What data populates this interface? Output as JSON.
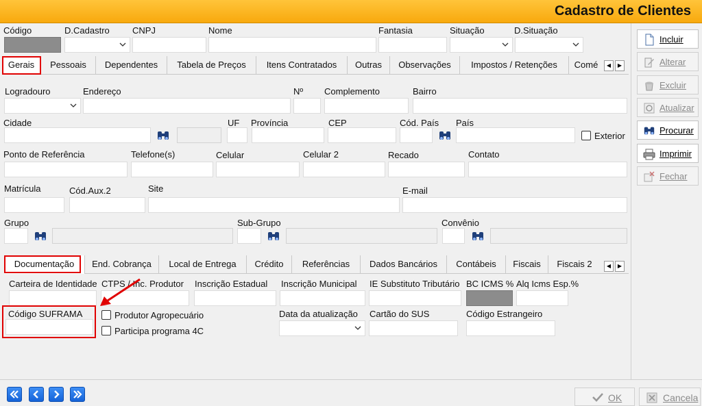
{
  "window": {
    "title": "Cadastro de Clientes"
  },
  "header_fields": {
    "codigo": "Código",
    "d_cadastro": "D.Cadastro",
    "cnpj": "CNPJ",
    "nome": "Nome",
    "fantasia": "Fantasia",
    "situacao": "Situação",
    "d_situacao": "D.Situação"
  },
  "main_tabs": [
    "Gerais",
    "Pessoais",
    "Dependentes",
    "Tabela de Preços",
    "Itens Contratados",
    "Outras",
    "Observações",
    "Impostos / Retenções",
    "Comé"
  ],
  "gerais": {
    "logradouro": "Logradouro",
    "endereco": "Endereço",
    "numero": "Nº",
    "complemento": "Complemento",
    "bairro": "Bairro",
    "cidade": "Cidade",
    "uf": "UF",
    "provincia": "Província",
    "cep": "CEP",
    "cod_pais": "Cód. País",
    "pais": "País",
    "exterior": "Exterior",
    "ponto_referencia": "Ponto de Referência",
    "telefones": "Telefone(s)",
    "celular": "Celular",
    "celular2": "Celular 2",
    "recado": "Recado",
    "contato": "Contato",
    "matricula": "Matrícula",
    "cod_aux2": "Cód.Aux.2",
    "site": "Site",
    "email": "E-mail",
    "grupo": "Grupo",
    "sub_grupo": "Sub-Grupo",
    "convenio": "Convênio"
  },
  "sub_tabs": [
    "Documentação",
    "End. Cobrança",
    "Local de Entrega",
    "Crédito",
    "Referências",
    "Dados Bancários",
    "Contábeis",
    "Fiscais",
    "Fiscais 2"
  ],
  "documentacao": {
    "carteira_identidade": "Carteira de Identidade",
    "ctps": "CTPS / Inc. Produtor",
    "inscricao_estadual": "Inscrição Estadual",
    "inscricao_municipal": "Inscrição Municipal",
    "ie_substituto": "IE Substituto Tributário",
    "bc_icms": "BC ICMS %",
    "alq_icms": "Alq Icms Esp.%",
    "codigo_suframa": "Código SUFRAMA",
    "produtor_agropecuario": "Produtor Agropecuário",
    "participa_4c": "Participa programa 4C",
    "data_atualizacao": "Data da atualização",
    "cartao_sus": "Cartão do SUS",
    "codigo_estrangeiro": "Código Estrangeiro"
  },
  "side_buttons": [
    {
      "label": "Incluir",
      "icon": "new-doc-icon",
      "enabled": true
    },
    {
      "label": "Alterar",
      "icon": "edit-icon",
      "enabled": false
    },
    {
      "label": "Excluir",
      "icon": "trash-icon",
      "enabled": false
    },
    {
      "label": "Atualizar",
      "icon": "refresh-icon",
      "enabled": false
    },
    {
      "label": "Procurar",
      "icon": "binoculars-icon",
      "enabled": true
    },
    {
      "label": "Imprimir",
      "icon": "printer-icon",
      "enabled": true
    },
    {
      "label": "Fechar",
      "icon": "close-doc-icon",
      "enabled": false
    }
  ],
  "footer": {
    "ok": "OK",
    "cancela": "Cancela"
  },
  "colors": {
    "title_bar": "#f8a90d",
    "highlight": "#e00000",
    "nav_blue": "#1563d8"
  }
}
